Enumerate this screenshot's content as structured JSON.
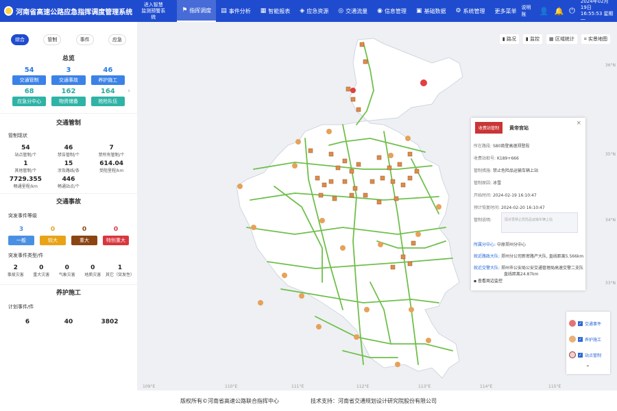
{
  "header": {
    "title": "河南省高速公路应急指挥调度管理系统",
    "portal_line1": "进入智慧",
    "portal_line2": "监测预警系统",
    "nav": [
      {
        "label": "指挥调度",
        "icon": "flag-icon"
      },
      {
        "label": "事件分析",
        "icon": "chart-icon"
      },
      {
        "label": "智能报表",
        "icon": "report-icon"
      },
      {
        "label": "应急资源",
        "icon": "resource-icon"
      },
      {
        "label": "交通流量",
        "icon": "traffic-icon"
      },
      {
        "label": "信息管理",
        "icon": "info-icon"
      },
      {
        "label": "基础数据",
        "icon": "data-icon"
      },
      {
        "label": "系统管理",
        "icon": "settings-icon"
      },
      {
        "label": "更多菜单",
        "icon": ""
      }
    ],
    "user": "说明账",
    "date": "2024年02月19日",
    "time": "16:55:53 星期一"
  },
  "left": {
    "tabs": [
      "综合",
      "管制",
      "事件",
      "应急"
    ],
    "overview_title": "总览",
    "overview_row1": [
      {
        "value": "54",
        "label": "交通管制"
      },
      {
        "value": "3",
        "label": "交通事故"
      },
      {
        "value": "46",
        "label": "养护施工"
      }
    ],
    "overview_row2": [
      {
        "value": "68",
        "label": "应急分中心"
      },
      {
        "value": "162",
        "label": "物资储备"
      },
      {
        "value": "164",
        "label": "抢险队伍"
      }
    ],
    "control_title": "交通管制",
    "control_sub": "管制现状",
    "control_stats": [
      {
        "value": "54",
        "label": "站点管制/个"
      },
      {
        "value": "46",
        "label": "禁告管制/个"
      },
      {
        "value": "7",
        "label": "禁所有管制/个"
      },
      {
        "value": "1",
        "label": "其他管制/个"
      },
      {
        "value": "15",
        "label": "涉及路线/条"
      },
      {
        "value": "614.04",
        "label": "受阻里程/km"
      },
      {
        "value": "7729.355",
        "label": "畅通里程/km"
      },
      {
        "value": "446",
        "label": "畅通站点/个"
      }
    ],
    "accident_title": "交通事故",
    "level_sub": "突发事件等级",
    "levels": [
      {
        "value": "3",
        "label": "一般",
        "color": "#4a90e2"
      },
      {
        "value": "0",
        "label": "较大",
        "color": "#e8a317"
      },
      {
        "value": "0",
        "label": "重大",
        "color": "#8b4513"
      },
      {
        "value": "0",
        "label": "特别重大",
        "color": "#d9363e"
      }
    ],
    "type_sub": "突发事件类型/件",
    "types": [
      {
        "value": "2",
        "label": "事故灾害"
      },
      {
        "value": "0",
        "label": "重大灾害"
      },
      {
        "value": "0",
        "label": "气象灾害"
      },
      {
        "value": "0",
        "label": "地质灾害"
      },
      {
        "value": "1",
        "label": "其它（突发性）"
      }
    ],
    "maint_title": "养护施工",
    "maint_sub": "计划事件/件",
    "maint_values": [
      "6",
      "40",
      "3802"
    ]
  },
  "map": {
    "toolbar": [
      "路况",
      "监控",
      "区域统计",
      "实景地图"
    ],
    "popup": {
      "tag": "收费站管制",
      "name": "黄帝宫站",
      "rows": [
        {
          "k": "所在路段:",
          "v": "S80商登高速郑登段"
        },
        {
          "k": "收费站桩号:",
          "v": "K189+666"
        },
        {
          "k": "管制措施:",
          "v": "禁止危险品运输车辆上站"
        },
        {
          "k": "管制原因:",
          "v": "冰雪"
        },
        {
          "k": "开始时间:",
          "v": "2024-02-19 16:10:47"
        },
        {
          "k": "预计恢复时间:",
          "v": "2024-02-20 16:10:47"
        },
        {
          "k": "管制说明:",
          "v": ""
        }
      ],
      "note": "因冰雪禁止危险品运输车辆上站",
      "center_k": "所属分中心:",
      "center_v": "中原郑州分中心",
      "police_k": "就近路政大队:",
      "police_v": "郑州分公司新密路产大队, 直线距离5.566km",
      "traffic_k": "就近交警大队:",
      "traffic_v1": "郑州市公安局公安交通管理局高速交警二支队",
      "traffic_v2": "直线距离24.87km",
      "link": "查看周边监控"
    },
    "legend": [
      "交通事件",
      "养护施工",
      "站点管制"
    ],
    "lon_labels": [
      "109°E",
      "110°E",
      "111°E",
      "112°E",
      "113°E",
      "114°E",
      "115°E"
    ],
    "lat_labels": [
      "36°N",
      "35°N",
      "34°N",
      "33°N"
    ]
  },
  "footer": {
    "copyright": "版权所有©河南省高速公路联合指挥中心",
    "support": "技术支持：河南省交通规划设计研究院股份有限公司"
  }
}
